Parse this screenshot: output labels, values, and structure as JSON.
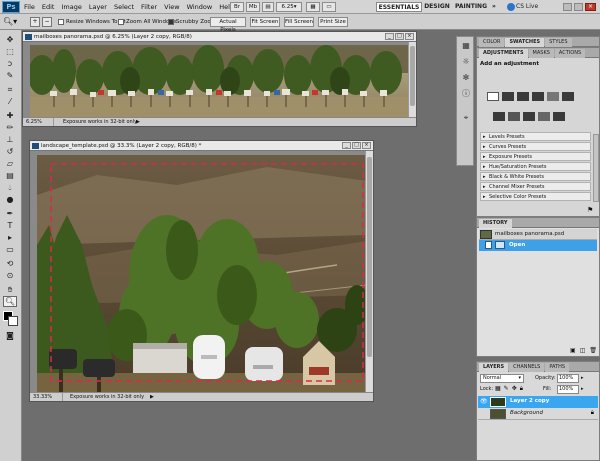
{
  "app": {
    "logo": "Ps",
    "menus": [
      "File",
      "Edit",
      "Image",
      "Layer",
      "Select",
      "Filter",
      "View",
      "Window",
      "Help"
    ],
    "zoom_level": "6.25",
    "workspaces": {
      "essentials": "ESSENTIALS",
      "design": "DESIGN",
      "painting": "PAINTING",
      "more": "»"
    },
    "cs_live": "CS Live"
  },
  "options": {
    "resize_windows": "Resize Windows To Fit",
    "zoom_all_windows": "Zoom All Windows",
    "scrubby_zoom": "Scrubby Zoom",
    "actual_pixels": "Actual Pixels",
    "fit_screen": "Fit Screen",
    "fill_screen": "Fill Screen",
    "print_size": "Print Size"
  },
  "documents": [
    {
      "title": "mailboxes panorama.psd @ 6.25% (Layer 2 copy, RGB/8)",
      "zoom": "6.25%",
      "status": "Exposure works in 32-bit only"
    },
    {
      "title": "landscape_template.psd @ 33.3% (Layer 2 copy, RGB/8) *",
      "zoom": "33.33%",
      "status": "Exposure works in 32-bit only"
    }
  ],
  "top_panel": {
    "tabs": [
      "COLOR",
      "SWATCHES",
      "STYLES"
    ]
  },
  "adjustments": {
    "tabs": [
      "ADJUSTMENTS",
      "MASKS",
      "ACTIONS"
    ],
    "header": "Add an adjustment",
    "presets": [
      "Levels Presets",
      "Curves Presets",
      "Exposure Presets",
      "Hue/Saturation Presets",
      "Black & White Presets",
      "Channel Mixer Presets",
      "Selective Color Presets"
    ]
  },
  "history": {
    "tab": "HISTORY",
    "items": [
      {
        "label": "mailboxes panorama.psd"
      },
      {
        "label": "Open"
      }
    ]
  },
  "layers": {
    "tabs": [
      "LAYERS",
      "CHANNELS",
      "PATHS"
    ],
    "blend_mode": "Normal",
    "opacity_label": "Opacity:",
    "opacity": "100%",
    "lock_label": "Lock:",
    "fill_label": "Fill:",
    "fill": "100%",
    "items": [
      {
        "name": "Layer 2 copy"
      },
      {
        "name": "Background"
      }
    ]
  },
  "colors": {
    "accent": "#3aa6f0",
    "selected_row": "#3ea0e8"
  }
}
